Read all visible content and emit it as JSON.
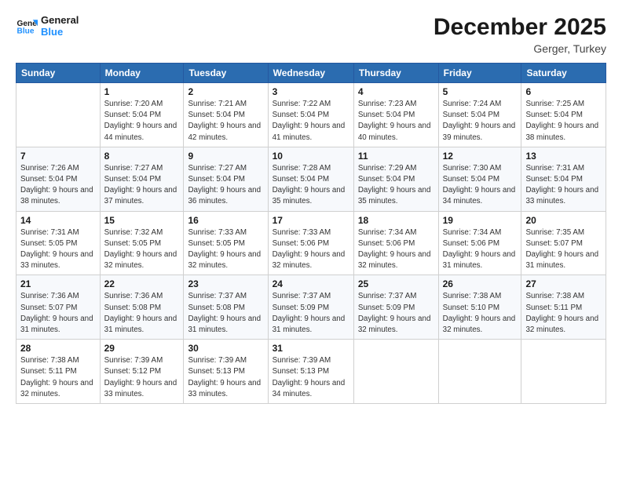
{
  "logo": {
    "line1": "General",
    "line2": "Blue"
  },
  "title": "December 2025",
  "location": "Gerger, Turkey",
  "days_of_week": [
    "Sunday",
    "Monday",
    "Tuesday",
    "Wednesday",
    "Thursday",
    "Friday",
    "Saturday"
  ],
  "weeks": [
    [
      {
        "day": "",
        "sunrise": "",
        "sunset": "",
        "daylight": ""
      },
      {
        "day": "1",
        "sunrise": "Sunrise: 7:20 AM",
        "sunset": "Sunset: 5:04 PM",
        "daylight": "Daylight: 9 hours and 44 minutes."
      },
      {
        "day": "2",
        "sunrise": "Sunrise: 7:21 AM",
        "sunset": "Sunset: 5:04 PM",
        "daylight": "Daylight: 9 hours and 42 minutes."
      },
      {
        "day": "3",
        "sunrise": "Sunrise: 7:22 AM",
        "sunset": "Sunset: 5:04 PM",
        "daylight": "Daylight: 9 hours and 41 minutes."
      },
      {
        "day": "4",
        "sunrise": "Sunrise: 7:23 AM",
        "sunset": "Sunset: 5:04 PM",
        "daylight": "Daylight: 9 hours and 40 minutes."
      },
      {
        "day": "5",
        "sunrise": "Sunrise: 7:24 AM",
        "sunset": "Sunset: 5:04 PM",
        "daylight": "Daylight: 9 hours and 39 minutes."
      },
      {
        "day": "6",
        "sunrise": "Sunrise: 7:25 AM",
        "sunset": "Sunset: 5:04 PM",
        "daylight": "Daylight: 9 hours and 38 minutes."
      }
    ],
    [
      {
        "day": "7",
        "sunrise": "Sunrise: 7:26 AM",
        "sunset": "Sunset: 5:04 PM",
        "daylight": "Daylight: 9 hours and 38 minutes."
      },
      {
        "day": "8",
        "sunrise": "Sunrise: 7:27 AM",
        "sunset": "Sunset: 5:04 PM",
        "daylight": "Daylight: 9 hours and 37 minutes."
      },
      {
        "day": "9",
        "sunrise": "Sunrise: 7:27 AM",
        "sunset": "Sunset: 5:04 PM",
        "daylight": "Daylight: 9 hours and 36 minutes."
      },
      {
        "day": "10",
        "sunrise": "Sunrise: 7:28 AM",
        "sunset": "Sunset: 5:04 PM",
        "daylight": "Daylight: 9 hours and 35 minutes."
      },
      {
        "day": "11",
        "sunrise": "Sunrise: 7:29 AM",
        "sunset": "Sunset: 5:04 PM",
        "daylight": "Daylight: 9 hours and 35 minutes."
      },
      {
        "day": "12",
        "sunrise": "Sunrise: 7:30 AM",
        "sunset": "Sunset: 5:04 PM",
        "daylight": "Daylight: 9 hours and 34 minutes."
      },
      {
        "day": "13",
        "sunrise": "Sunrise: 7:31 AM",
        "sunset": "Sunset: 5:04 PM",
        "daylight": "Daylight: 9 hours and 33 minutes."
      }
    ],
    [
      {
        "day": "14",
        "sunrise": "Sunrise: 7:31 AM",
        "sunset": "Sunset: 5:05 PM",
        "daylight": "Daylight: 9 hours and 33 minutes."
      },
      {
        "day": "15",
        "sunrise": "Sunrise: 7:32 AM",
        "sunset": "Sunset: 5:05 PM",
        "daylight": "Daylight: 9 hours and 32 minutes."
      },
      {
        "day": "16",
        "sunrise": "Sunrise: 7:33 AM",
        "sunset": "Sunset: 5:05 PM",
        "daylight": "Daylight: 9 hours and 32 minutes."
      },
      {
        "day": "17",
        "sunrise": "Sunrise: 7:33 AM",
        "sunset": "Sunset: 5:06 PM",
        "daylight": "Daylight: 9 hours and 32 minutes."
      },
      {
        "day": "18",
        "sunrise": "Sunrise: 7:34 AM",
        "sunset": "Sunset: 5:06 PM",
        "daylight": "Daylight: 9 hours and 32 minutes."
      },
      {
        "day": "19",
        "sunrise": "Sunrise: 7:34 AM",
        "sunset": "Sunset: 5:06 PM",
        "daylight": "Daylight: 9 hours and 31 minutes."
      },
      {
        "day": "20",
        "sunrise": "Sunrise: 7:35 AM",
        "sunset": "Sunset: 5:07 PM",
        "daylight": "Daylight: 9 hours and 31 minutes."
      }
    ],
    [
      {
        "day": "21",
        "sunrise": "Sunrise: 7:36 AM",
        "sunset": "Sunset: 5:07 PM",
        "daylight": "Daylight: 9 hours and 31 minutes."
      },
      {
        "day": "22",
        "sunrise": "Sunrise: 7:36 AM",
        "sunset": "Sunset: 5:08 PM",
        "daylight": "Daylight: 9 hours and 31 minutes."
      },
      {
        "day": "23",
        "sunrise": "Sunrise: 7:37 AM",
        "sunset": "Sunset: 5:08 PM",
        "daylight": "Daylight: 9 hours and 31 minutes."
      },
      {
        "day": "24",
        "sunrise": "Sunrise: 7:37 AM",
        "sunset": "Sunset: 5:09 PM",
        "daylight": "Daylight: 9 hours and 31 minutes."
      },
      {
        "day": "25",
        "sunrise": "Sunrise: 7:37 AM",
        "sunset": "Sunset: 5:09 PM",
        "daylight": "Daylight: 9 hours and 32 minutes."
      },
      {
        "day": "26",
        "sunrise": "Sunrise: 7:38 AM",
        "sunset": "Sunset: 5:10 PM",
        "daylight": "Daylight: 9 hours and 32 minutes."
      },
      {
        "day": "27",
        "sunrise": "Sunrise: 7:38 AM",
        "sunset": "Sunset: 5:11 PM",
        "daylight": "Daylight: 9 hours and 32 minutes."
      }
    ],
    [
      {
        "day": "28",
        "sunrise": "Sunrise: 7:38 AM",
        "sunset": "Sunset: 5:11 PM",
        "daylight": "Daylight: 9 hours and 32 minutes."
      },
      {
        "day": "29",
        "sunrise": "Sunrise: 7:39 AM",
        "sunset": "Sunset: 5:12 PM",
        "daylight": "Daylight: 9 hours and 33 minutes."
      },
      {
        "day": "30",
        "sunrise": "Sunrise: 7:39 AM",
        "sunset": "Sunset: 5:13 PM",
        "daylight": "Daylight: 9 hours and 33 minutes."
      },
      {
        "day": "31",
        "sunrise": "Sunrise: 7:39 AM",
        "sunset": "Sunset: 5:13 PM",
        "daylight": "Daylight: 9 hours and 34 minutes."
      },
      {
        "day": "",
        "sunrise": "",
        "sunset": "",
        "daylight": ""
      },
      {
        "day": "",
        "sunrise": "",
        "sunset": "",
        "daylight": ""
      },
      {
        "day": "",
        "sunrise": "",
        "sunset": "",
        "daylight": ""
      }
    ]
  ]
}
